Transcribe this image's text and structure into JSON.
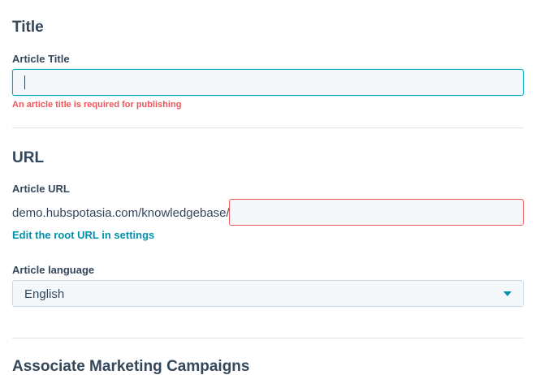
{
  "title_section": {
    "heading": "Title",
    "article_title_label": "Article Title",
    "article_title_value": "",
    "error_message": "An article title is required for publishing"
  },
  "url_section": {
    "heading": "URL",
    "article_url_label": "Article URL",
    "url_prefix": "demo.hubspotasia.com/knowledgebase/",
    "slug_value": "",
    "edit_root_link": "Edit the root URL in settings",
    "language_label": "Article language",
    "language_selected": "English"
  },
  "campaigns_section": {
    "heading": "Associate Marketing Campaigns"
  },
  "colors": {
    "text": "#33475b",
    "accent": "#0091ae",
    "focus_border": "#00a4bd",
    "error": "#f2545b",
    "input_bg": "#f5f8fa"
  },
  "icons": {
    "language_dropdown": "caret-down-icon"
  }
}
